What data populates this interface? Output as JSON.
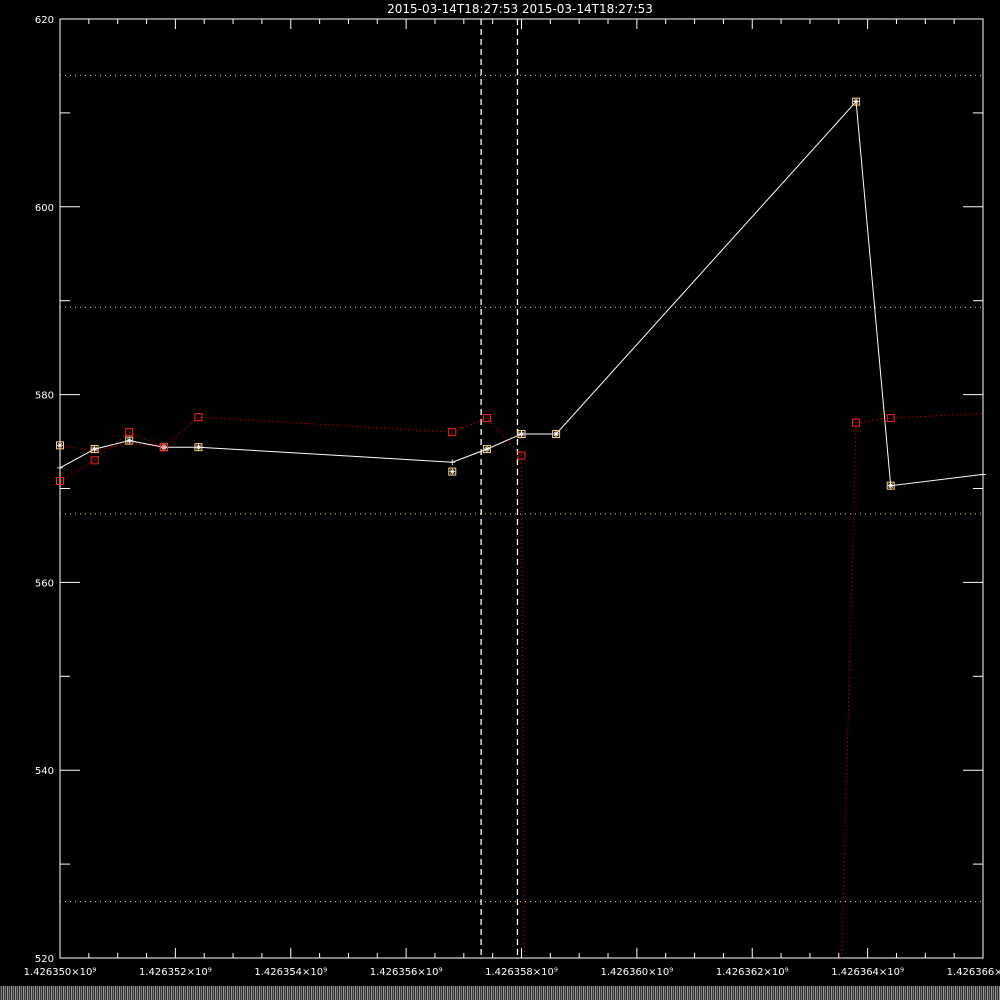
{
  "chart_data": {
    "type": "line",
    "title": "2015-03-14T18:27:53  2015-03-14T18:27:53",
    "xlim": [
      1426350000,
      1426366000
    ],
    "ylim": [
      520,
      620
    ],
    "x_tick_labels": [
      "1.426350×10⁹",
      "1.426352×10⁹",
      "1.426354×10⁹",
      "1.426356×10⁹",
      "1.426358×10⁹",
      "1.426360×10⁹",
      "1.426362×10⁹",
      "1.426364×10⁹",
      "1.426366×10⁹"
    ],
    "y_tick_labels": [
      "520",
      "540",
      "560",
      "580",
      "600",
      "620"
    ],
    "y_ticks": [
      520,
      540,
      560,
      580,
      600,
      620
    ],
    "x_ticks": [
      1426350000,
      1426352000,
      1426354000,
      1426356000,
      1426358000,
      1426360000,
      1426362000,
      1426364000,
      1426366000
    ],
    "reference_lines_y": [
      614,
      589.3,
      567.3,
      526
    ],
    "time_markers_x": [
      1426357300,
      1426357930
    ],
    "series": [
      {
        "color": "#ffffff",
        "style": "solid",
        "x": [
          1426349400,
          1426350000,
          1426350600,
          1426351200,
          1426351800,
          1426352400,
          1426356800,
          1426357400,
          1426358000,
          1426358600,
          1426363800,
          1426364400,
          1426366000
        ],
        "y": [
          572.8,
          572.2,
          574.2,
          575.1,
          574.4,
          574.4,
          572.8,
          574.2,
          575.8,
          575.8,
          611.2,
          570.3,
          571.5
        ]
      },
      {
        "color": "#ffd27f",
        "style": "marker",
        "x": [
          1426350000,
          1426350600,
          1426351200,
          1426351800,
          1426352400,
          1426356800,
          1426357400,
          1426358000,
          1426358600,
          1426363800,
          1426364400
        ],
        "y": [
          574.6,
          574.2,
          575.1,
          574.4,
          574.4,
          571.8,
          574.2,
          575.8,
          575.8,
          611.2,
          570.3
        ]
      },
      {
        "color": "#ff0000",
        "style": "dotted",
        "x": [
          1426349400,
          1426350000,
          1426350600,
          1426351200,
          1426351800,
          1426352400,
          1426356800,
          1426357400,
          1426358000,
          1426358050,
          null,
          1426363550,
          1426363800,
          1426364400,
          1426366000
        ],
        "y": [
          575,
          574.6,
          574,
          574.8,
          574.4,
          577.6,
          576,
          577.5,
          573.5,
          520,
          null,
          520,
          577,
          577.5,
          578
        ]
      },
      {
        "color": "#ff0000",
        "style": "dotted",
        "x": [
          1426349400,
          1426350000,
          1426350600,
          1426351200,
          1426351800
        ],
        "y": [
          571.2,
          570.8,
          573,
          576,
          574.4
        ]
      },
      {
        "color": "#ff2020",
        "style": "marker",
        "x": [
          1426350000,
          1426350600,
          1426351200,
          1426351800,
          1426352400,
          1426356800,
          1426357400,
          1426358000,
          1426363800,
          1426364400
        ],
        "y": [
          570.8,
          573,
          576,
          574.4,
          577.6,
          576,
          577.5,
          573.5,
          577,
          577.5
        ]
      }
    ]
  }
}
